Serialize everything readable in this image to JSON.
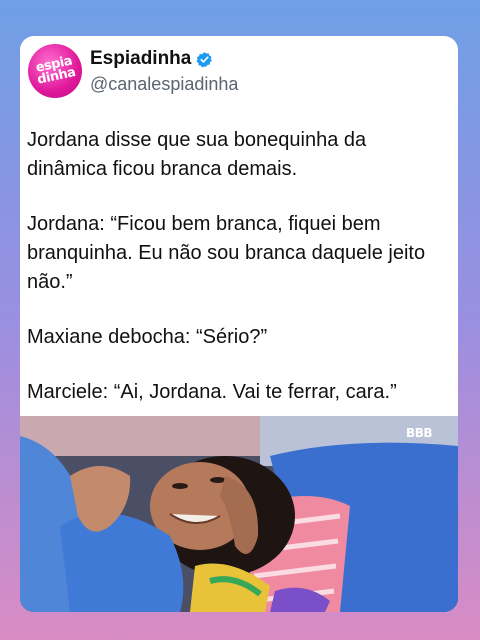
{
  "account": {
    "name": "Espiadinha",
    "handle": "@canalespiadinha",
    "avatar_text_line1": "espia",
    "avatar_text_line2": "dinha"
  },
  "tweet": {
    "paragraphs": [
      "Jordana disse que sua bonequinha da dinâmica ficou branca demais.",
      "Jordana: “Ficou bem branca, fiquei bem branquinha. Eu não sou branca daquele jeito não.”",
      "Maxiane debocha: “Sério?”",
      "Marciele: “Ai, Jordana. Vai te ferrar, cara.”"
    ]
  },
  "media": {
    "logo": "BBB"
  },
  "colors": {
    "background_top": "#6f9fe6",
    "background_bottom": "#d98cc4",
    "avatar": "#e0189a",
    "verified": "#1d9bf0"
  },
  "icons": [
    "verified-badge-icon"
  ]
}
